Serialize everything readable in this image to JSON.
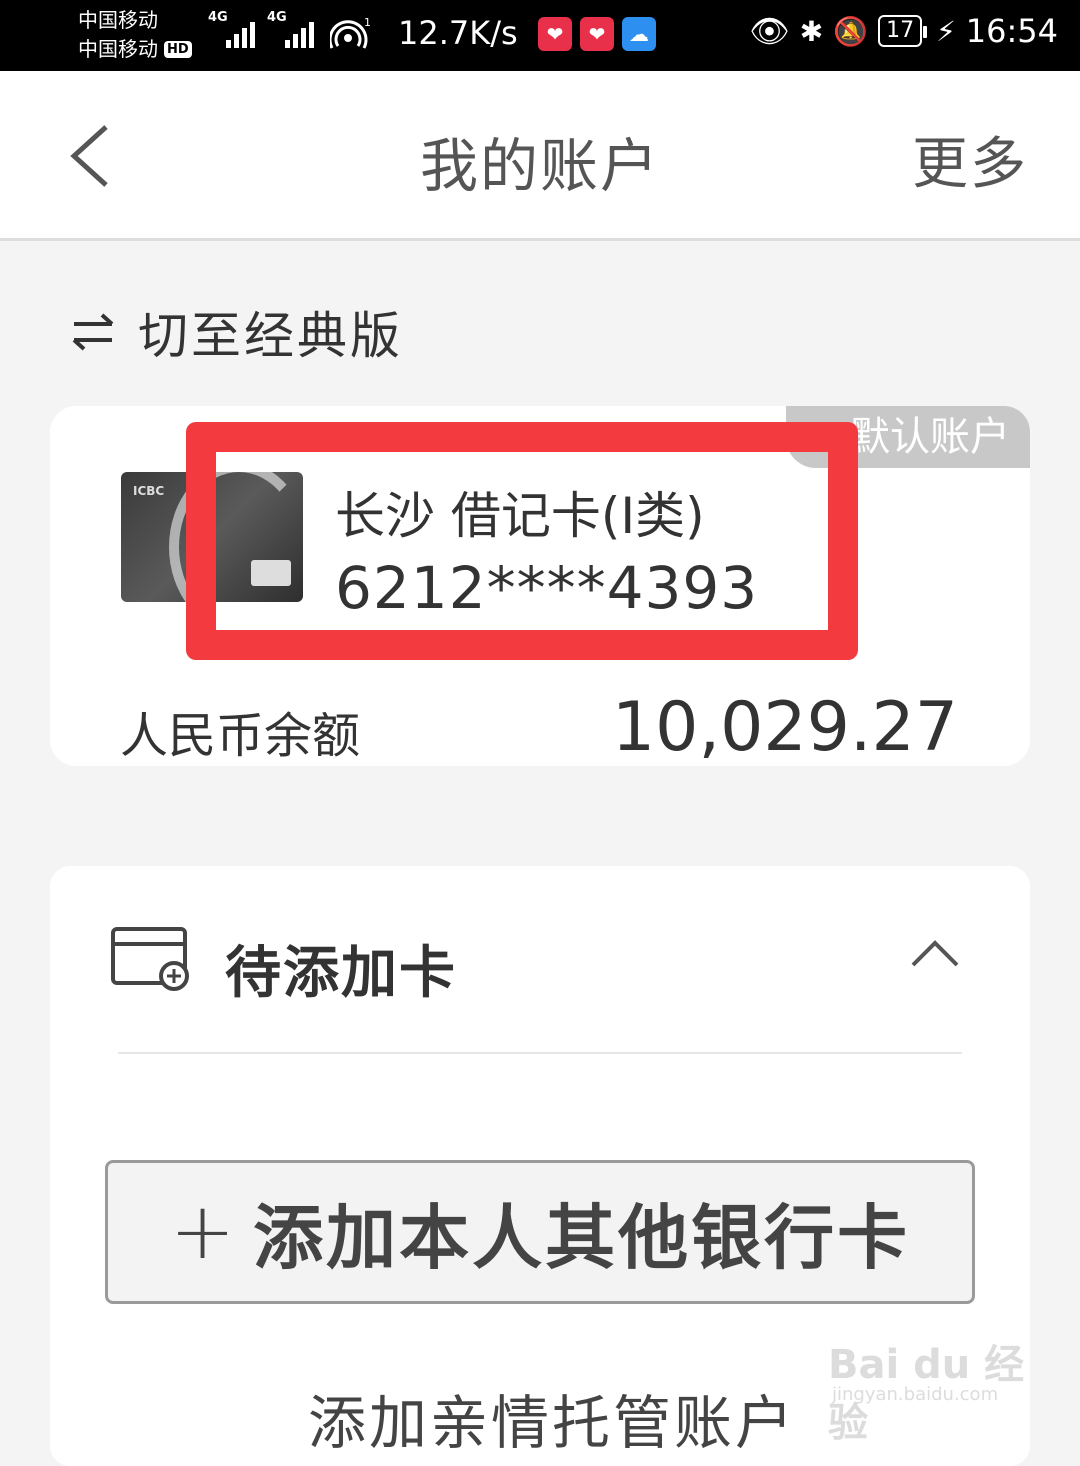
{
  "status_bar": {
    "carrier_1": "中国移动",
    "carrier_2": "中国移动",
    "hd_badge": "HD",
    "signal_1_label": "4G",
    "signal_2_label": "4G",
    "wifi_sub": "1",
    "speed": "12.7K/s",
    "battery": "17",
    "time": "16:54",
    "icons": [
      "eye-icon",
      "bluetooth-icon",
      "mute-icon",
      "charging-icon"
    ]
  },
  "header": {
    "title": "我的账户",
    "more_label": "更多"
  },
  "switch": {
    "label": "切至经典版"
  },
  "account_card": {
    "default_tag": "默认账户",
    "card_brand": "ICBC",
    "card_name": "长沙 借记卡(I类)",
    "card_number": "6212****4393",
    "balance_label": "人民币余额",
    "balance_value": "10,029.27"
  },
  "pending": {
    "title": "待添加卡",
    "add_button_label": "添加本人其他银行卡",
    "plus_symbol": "+",
    "family_account_label": "添加亲情托管账户"
  },
  "watermark": {
    "brand": "Bai du 经验",
    "url": "jingyan.baidu.com"
  },
  "colors": {
    "highlight": "#f23a3f",
    "status_bar": "#000000",
    "default_tag": "#c8c8c8"
  }
}
